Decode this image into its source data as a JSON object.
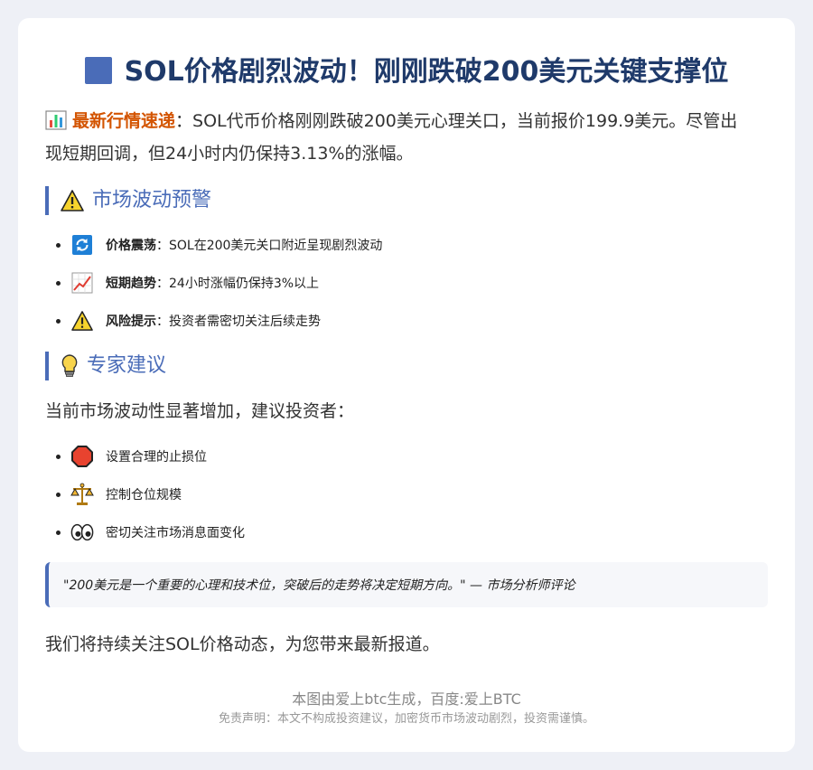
{
  "title": "SOL价格剧烈波动！刚刚跌破200美元关键支撑位",
  "intro": {
    "highlight": "最新行情速递",
    "colon": "：",
    "text": "SOL代币价格刚刚跌破200美元心理关口，当前报价199.9美元。尽管出现短期回调，但24小时内仍保持3.13%的涨幅。"
  },
  "section1": {
    "heading": "市场波动预警",
    "items": [
      {
        "icon": "refresh-icon",
        "label": "价格震荡",
        "text": "：SOL在200美元关口附近呈现剧烈波动"
      },
      {
        "icon": "trend-up-chart-icon",
        "label": "短期趋势",
        "text": "：24小时涨幅仍保持3%以上"
      },
      {
        "icon": "warning-icon",
        "label": "风险提示",
        "text": "：投资者需密切关注后续走势"
      }
    ]
  },
  "section2": {
    "heading": "专家建议",
    "lead": "当前市场波动性显著增加，建议投资者：",
    "items": [
      {
        "icon": "stop-sign-icon",
        "text": "设置合理的止损位"
      },
      {
        "icon": "balance-scale-icon",
        "text": "控制仓位规模"
      },
      {
        "icon": "eyes-icon",
        "text": "密切关注市场消息面变化"
      }
    ]
  },
  "quote": "\"200美元是一个重要的心理和技术位，突破后的走势将决定短期方向。\" — 市场分析师评论",
  "closing": "我们将持续关注SOL价格动态，为您带来最新报道。",
  "footer": {
    "credit": "本图由爱上btc生成，百度:爱上BTC",
    "disclaimer": "免责声明：本文不构成投资建议，加密货币市场波动剧烈，投资需谨慎。"
  },
  "colors": {
    "accent": "#4a6cb8",
    "title": "#1f3a6a",
    "highlight": "#d35400",
    "background": "#eef0f6"
  }
}
